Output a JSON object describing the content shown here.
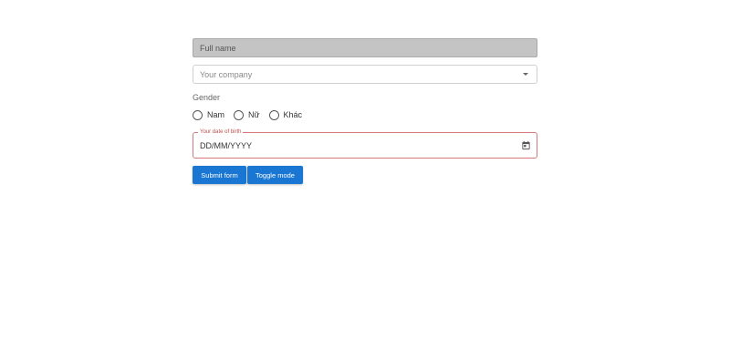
{
  "form": {
    "full_name_placeholder": "Full name",
    "company_placeholder": "Your company",
    "gender_label": "Gender",
    "gender_options": [
      "Nam",
      "Nữ",
      "Khác"
    ],
    "dob_label": "Your date of birth",
    "dob_placeholder": "DD/MM/YYYY",
    "submit_label": "Submit form",
    "toggle_label": "Toggle mode"
  },
  "colors": {
    "primary": "#1976d2",
    "error_border": "#d37b7b",
    "disabled_field": "#c4c4c4"
  },
  "icons": {
    "company_dropdown": "chevron-down-icon",
    "dob_picker": "calendar-icon"
  }
}
